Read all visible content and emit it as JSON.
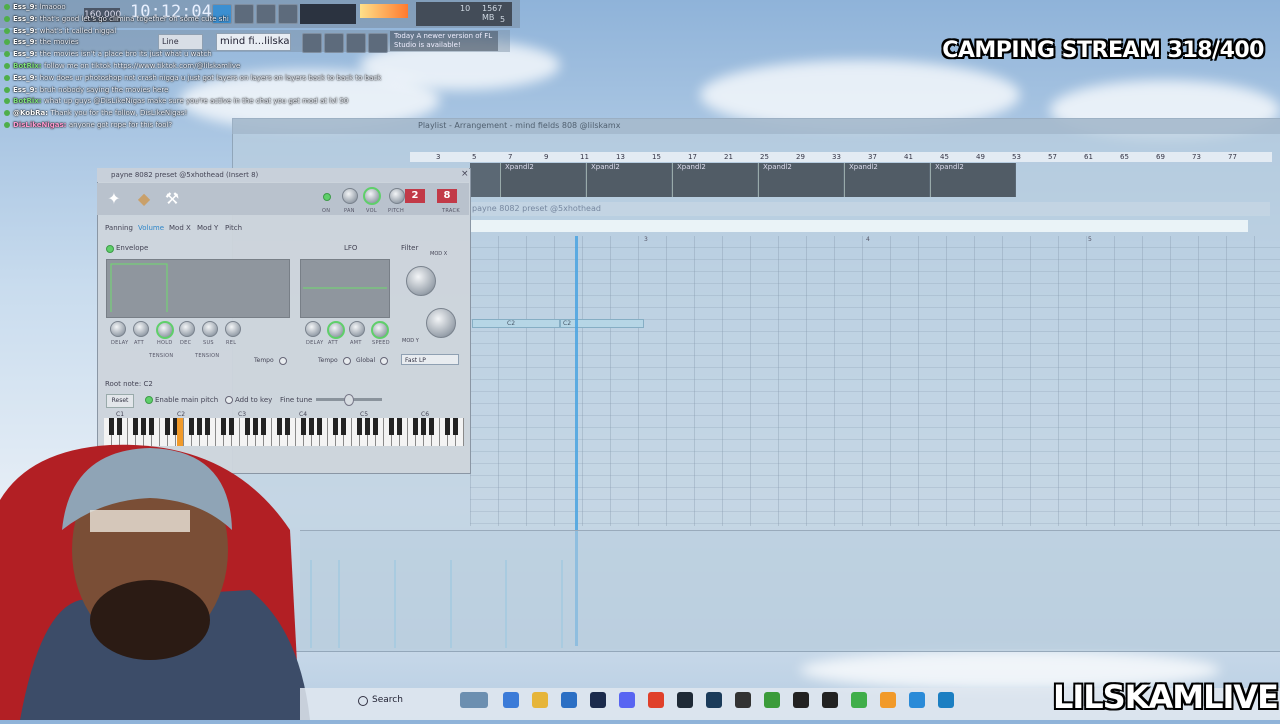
{
  "toolbar": {
    "time": "10:12:04",
    "tempo": "160.000",
    "project_name": "mind fi...lilskamx",
    "mode_select": "Line",
    "update_notice": "Today  A newer version of FL Studio is available!",
    "cpu_value": "10",
    "memory_value": "1567 MB",
    "poly_value": "5"
  },
  "chat": [
    {
      "user": "Ess_9",
      "text": "lmaooo",
      "color": "#ffffff"
    },
    {
      "user": "Ess_9",
      "text": "that's good let's go climina together on some cute shi",
      "color": "#ffffff"
    },
    {
      "user": "Ess_9",
      "text": "what's it called niggal",
      "color": "#ffffff"
    },
    {
      "user": "Ess_9",
      "text": "the movies",
      "color": "#ffffff"
    },
    {
      "user": "Ess_9",
      "text": "the movies isn't a place bro its just what u watch",
      "color": "#ffffff"
    },
    {
      "user": "BotRix",
      "text": "follow me on tiktok https://www.tiktok.com/@lilskamlive",
      "color": "#7fe07a"
    },
    {
      "user": "Ess_9",
      "text": "how does ur photoshop not crash nigga u just got layers on layers on layers back to back to back",
      "color": "#ffffff"
    },
    {
      "user": "Ess_9",
      "text": "bruh nobody saying the movies here",
      "color": "#ffffff"
    },
    {
      "user": "BotRix",
      "text": "what up guys @DisLikeNigas make sure you're active in the chat you get mod at lvl 50",
      "color": "#7fe07a"
    },
    {
      "user": "@KobRa",
      "text": "Thank you for the follow, DisLikeNigas!",
      "color": "#ffffff"
    },
    {
      "user": "DisLikeNigas",
      "text": "anyone got rope for this fool?",
      "color": "#ff9ad0"
    }
  ],
  "stream": {
    "title": "CAMPING STREAM 318/400",
    "brand": "LILSKAMLIVE"
  },
  "playlist": {
    "title": "Playlist - Arrangement - mind fields 808 @lilskamx",
    "ruler_numbers": [
      "3",
      "5",
      "7",
      "9",
      "11",
      "13",
      "15",
      "17",
      "21",
      "25",
      "29",
      "33",
      "37",
      "41",
      "45",
      "49",
      "53",
      "57",
      "61",
      "65",
      "69",
      "73",
      "77"
    ],
    "clip_label": "Xpandl2",
    "clips": [
      "Xpandl2",
      "Xpandl2",
      "Xpandl2",
      "Xpandl2",
      "Xpandl2",
      "Xpandl2"
    ]
  },
  "piano_roll": {
    "title": "payne 8082 preset @5xhothead",
    "bar_numbers": [
      "3",
      "4",
      "5"
    ],
    "notes": [
      {
        "label": "C2"
      },
      {
        "label": "C2"
      }
    ]
  },
  "channel_settings": {
    "title": "payne 8082 preset @5xhothead (Insert 8)",
    "track_value": "8",
    "pitch_value": "2",
    "knob_labels": {
      "on": "ON",
      "pan": "PAN",
      "vol": "VOL",
      "pitch": "PITCH",
      "track": "TRACK"
    },
    "tabs": [
      "Panning",
      "Volume",
      "Mod X",
      "Mod Y",
      "Pitch"
    ],
    "active_tab": "Volume",
    "envelope_label": "Envelope",
    "lfo_label": "LFO",
    "filter_label": "Filter",
    "mod_x_label": "MOD X",
    "mod_y_label": "MOD Y",
    "env_knobs": [
      "DELAY",
      "ATT",
      "HOLD",
      "DEC",
      "SUS",
      "REL"
    ],
    "tension_label": "TENSION",
    "lfo_knobs": [
      "DELAY",
      "ATT",
      "AMT",
      "SPEED"
    ],
    "tempo_label": "Tempo",
    "global_label": "Global",
    "filter_type": "Fast LP",
    "root_note": "Root note: C2",
    "reset_label": "Reset",
    "enable_main_pitch": "Enable main pitch",
    "add_to_key": "Add to key",
    "fine_tune": "Fine tune",
    "octaves": [
      "C1",
      "C2",
      "C3",
      "C4",
      "C5",
      "C6"
    ]
  },
  "taskbar": {
    "search_label": "Search"
  },
  "colors": {
    "accent_blue": "#2f86c8",
    "green_active": "#5fcf6a",
    "red_badge": "#c23a48"
  }
}
